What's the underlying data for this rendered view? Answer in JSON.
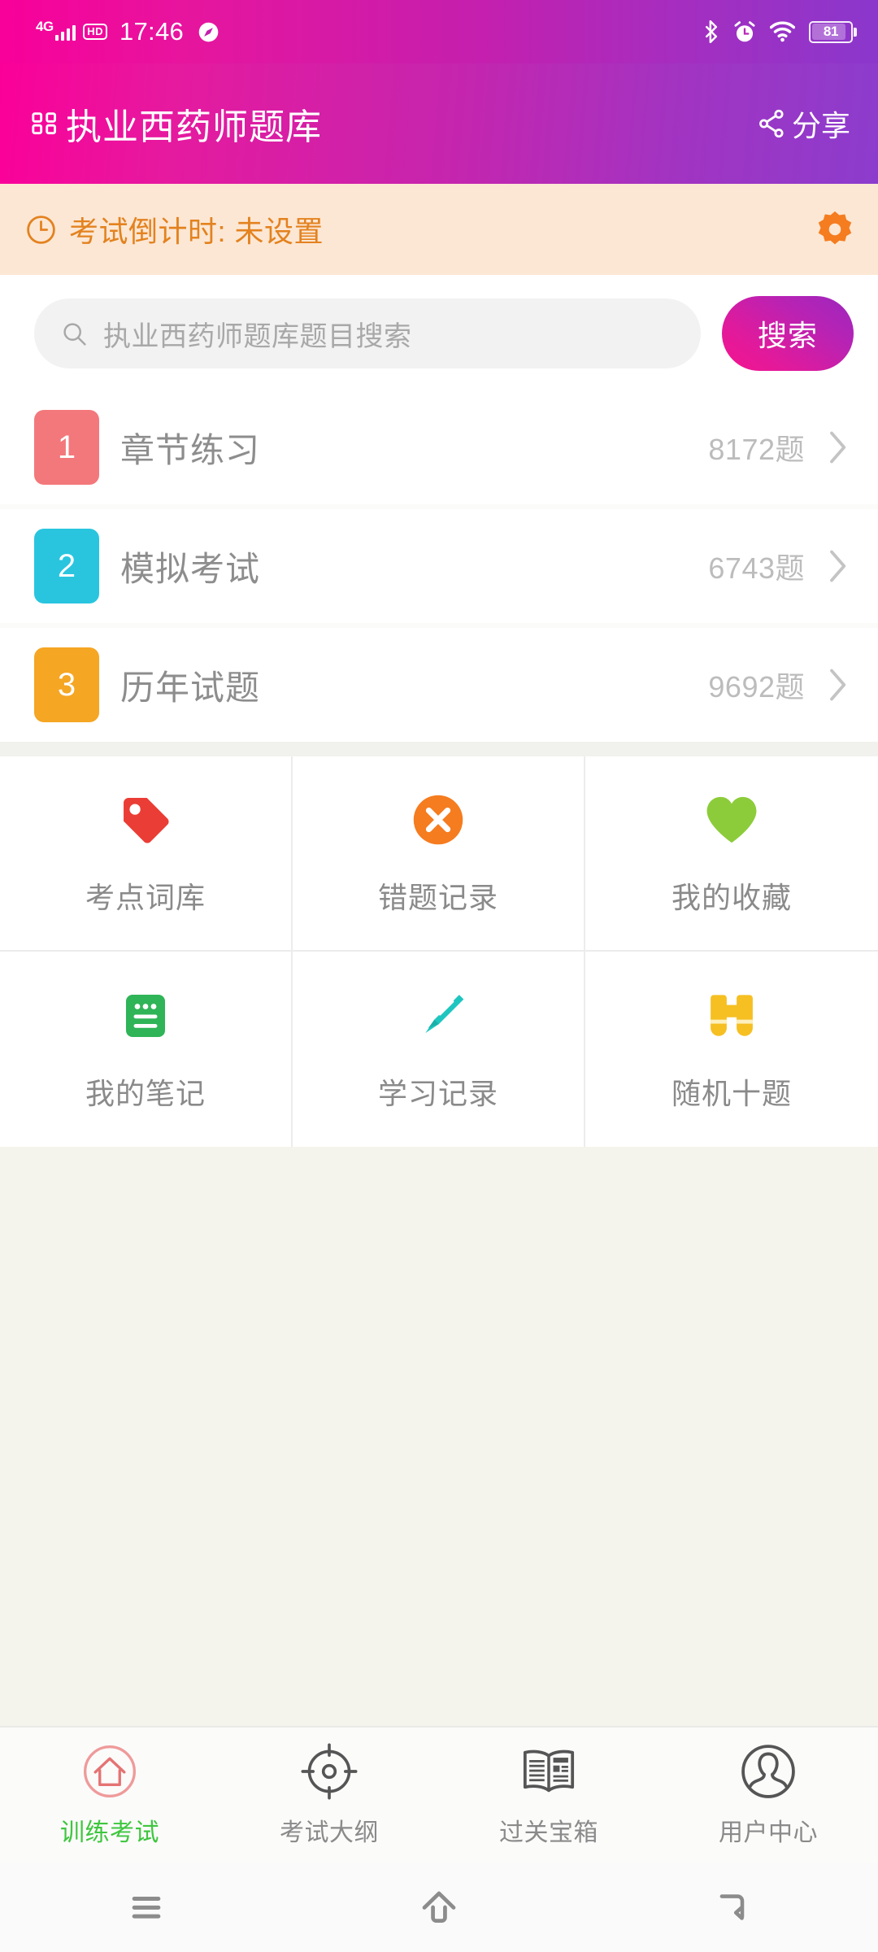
{
  "status_bar": {
    "network_type": "4G",
    "hd": "HD",
    "time": "17:46",
    "battery_level": "81",
    "icons": [
      "signal-bars-icon",
      "hd-icon",
      "speedometer-icon",
      "bluetooth-icon",
      "alarm-icon",
      "wifi-icon",
      "battery-icon"
    ]
  },
  "header": {
    "title": "执业西药师题库",
    "menu_icon": "grid-menu-icon",
    "share_label": "分享",
    "share_icon": "share-icon",
    "gradient_start": "#fb0099",
    "gradient_end": "#8c3ccd"
  },
  "countdown": {
    "text": "考试倒计时: 未设置",
    "clock_icon": "clock-icon",
    "settings_icon": "gear-icon",
    "background": "#fce7d4",
    "text_color": "#e3821f"
  },
  "search": {
    "placeholder": "执业西药师题库题目搜索",
    "value": "",
    "icon": "search-icon",
    "button_label": "搜索"
  },
  "list_rows": [
    {
      "number": "1",
      "title": "章节练习",
      "count": "8172题",
      "badge_color": "#f3787b",
      "chevron": "chevron-right-icon"
    },
    {
      "number": "2",
      "title": "模拟考试",
      "count": "6743题",
      "badge_color": "#29c5df",
      "chevron": "chevron-right-icon"
    },
    {
      "number": "3",
      "title": "历年试题",
      "count": "9692题",
      "badge_color": "#f5a623",
      "chevron": "chevron-right-icon"
    }
  ],
  "feature_grid": [
    {
      "label": "考点词库",
      "icon": "tag-icon",
      "color": "#ea3d35"
    },
    {
      "label": "错题记录",
      "icon": "close-circle-icon",
      "color": "#f57c1f"
    },
    {
      "label": "我的收藏",
      "icon": "heart-icon",
      "color": "#8ccc3a"
    },
    {
      "label": "我的笔记",
      "icon": "note-icon",
      "color": "#2fb457"
    },
    {
      "label": "学习记录",
      "icon": "pencil-icon",
      "color": "#1fc6c0"
    },
    {
      "label": "随机十题",
      "icon": "binoculars-icon",
      "color": "#f6bf22"
    }
  ],
  "tab_bar": {
    "active_color": "#3ec63e",
    "items": [
      {
        "label": "训练考试",
        "icon": "home-circle-icon",
        "active": true
      },
      {
        "label": "考试大纲",
        "icon": "target-icon",
        "active": false
      },
      {
        "label": "过关宝箱",
        "icon": "newspaper-icon",
        "active": false
      },
      {
        "label": "用户中心",
        "icon": "user-circle-icon",
        "active": false
      }
    ]
  },
  "android_nav": {
    "items": [
      {
        "icon": "recents-menu-icon"
      },
      {
        "icon": "home-icon"
      },
      {
        "icon": "back-icon"
      }
    ]
  }
}
